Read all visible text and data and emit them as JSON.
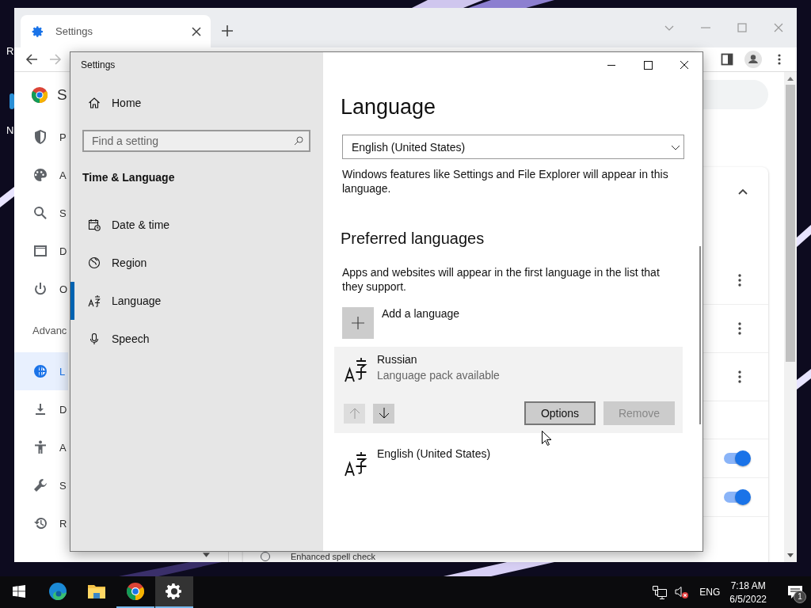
{
  "desktop": {
    "icon_labels": [
      "R",
      "N"
    ]
  },
  "browser": {
    "tabs": [
      {
        "title": "Settings",
        "selected": true
      }
    ],
    "sidebar": {
      "title": "S",
      "items": [
        {
          "kind": "item",
          "label": "P",
          "selected": false
        },
        {
          "kind": "item",
          "label": "A",
          "selected": false
        },
        {
          "kind": "item",
          "label": "S",
          "selected": false
        },
        {
          "kind": "item",
          "label": "D",
          "selected": false
        },
        {
          "kind": "item",
          "label": "O",
          "selected": false
        },
        {
          "kind": "heading",
          "label": "Advanc"
        },
        {
          "kind": "item",
          "label": "L",
          "selected": true
        },
        {
          "kind": "item",
          "label": "D",
          "selected": false
        },
        {
          "kind": "item",
          "label": "A",
          "selected": false
        },
        {
          "kind": "item",
          "label": "S",
          "selected": false
        },
        {
          "kind": "item",
          "label": "R",
          "selected": false
        }
      ]
    },
    "card": {
      "expanded": true,
      "rows": [
        {
          "kind": "menu"
        },
        {
          "kind": "menu"
        },
        {
          "kind": "menu"
        },
        {
          "kind": "gap"
        },
        {
          "kind": "toggle",
          "on": true
        },
        {
          "kind": "toggle",
          "on": true
        }
      ]
    },
    "spell_check": {
      "label": "Enhanced spell check",
      "selected": false
    }
  },
  "settings": {
    "title": "Settings",
    "home": "Home",
    "search_placeholder": "Find a setting",
    "section": "Time & Language",
    "nav": [
      {
        "label": "Date & time",
        "selected": false
      },
      {
        "label": "Region",
        "selected": false
      },
      {
        "label": "Language",
        "selected": true
      },
      {
        "label": "Speech",
        "selected": false
      }
    ],
    "heading": "Language",
    "display_language": "English (United States)",
    "display_note": "Windows features like Settings and File Explorer will appear in this language.",
    "preferred_heading": "Preferred languages",
    "preferred_note": "Apps and websites will appear in the first language in the list that they support.",
    "add_label": "Add a language",
    "languages": [
      {
        "name": "Russian",
        "status": "Language pack available",
        "selected": true,
        "move_up_disabled": true,
        "move_down_disabled": false,
        "actions": [
          {
            "label": "Options",
            "disabled": false,
            "focused": true
          },
          {
            "label": "Remove",
            "disabled": true,
            "focused": false
          }
        ]
      },
      {
        "name": "English (United States)",
        "selected": false
      }
    ]
  },
  "taskbar": {
    "apps": [
      {
        "running": false,
        "active": false
      },
      {
        "running": false,
        "active": false
      },
      {
        "running": true,
        "active": false
      },
      {
        "running": true,
        "active": true
      }
    ],
    "tray": {
      "language": "ENG",
      "time": "7:18 AM",
      "date": "6/5/2022",
      "notification_count": "1"
    }
  }
}
